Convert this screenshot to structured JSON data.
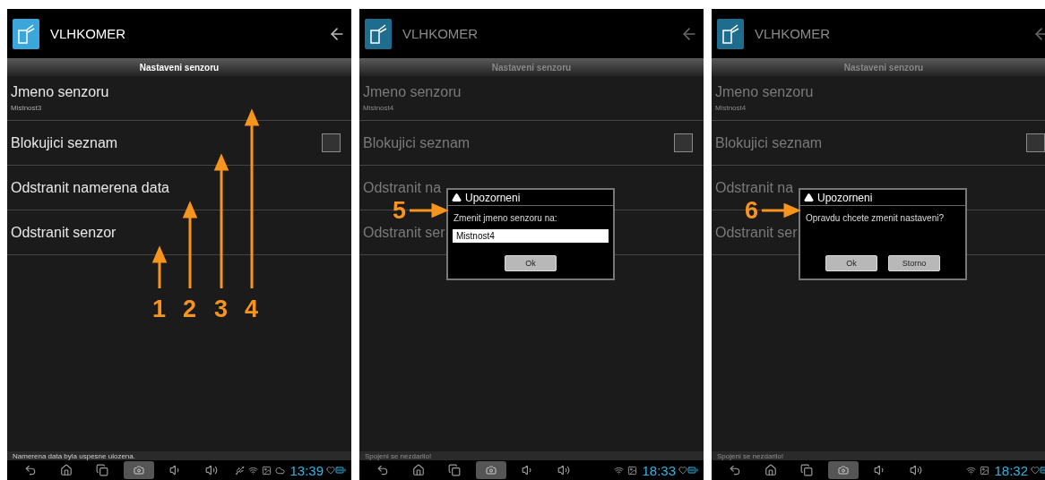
{
  "screens": [
    {
      "app_title": "VLHKOMER",
      "section": "Nastaveni senzoru",
      "dimmed": false,
      "rows": [
        {
          "kind": "text",
          "title": "Jmeno senzoru",
          "subtitle": "Mistnost3"
        },
        {
          "kind": "checkbox",
          "title": "Blokujici seznam",
          "checked": false
        },
        {
          "kind": "text",
          "title": "Odstranit namerena data"
        },
        {
          "kind": "text",
          "title": "Odstranit senzor"
        }
      ],
      "annotations": [
        {
          "label": "1"
        },
        {
          "label": "2"
        },
        {
          "label": "3"
        },
        {
          "label": "4"
        }
      ],
      "status_message": "Namerena data byla uspesne ulozena.",
      "status_icons": [
        {
          "kind": "usb"
        },
        {
          "kind": "wifi"
        },
        {
          "kind": "image"
        },
        {
          "kind": "cloud"
        }
      ],
      "time": "13:39"
    },
    {
      "app_title": "VLHKOMER",
      "section": "Nastaveni senzoru",
      "dimmed": true,
      "rows": [
        {
          "kind": "text",
          "title": "Jmeno senzoru",
          "subtitle": "Mistnost4"
        },
        {
          "kind": "checkbox",
          "title": "Blokujici seznam",
          "checked": false
        },
        {
          "kind": "text",
          "title": "Odstranit na"
        },
        {
          "kind": "text",
          "title": "Odstranit ser"
        }
      ],
      "annotations": [
        {
          "label": "5"
        }
      ],
      "dialog": {
        "title": "Upozorneni",
        "message": "Zmenit jmeno senzoru na:",
        "input_value": "Mistnost4",
        "buttons": [
          "Ok"
        ]
      },
      "status_message": "Spojeni se nezdarilo!",
      "status_icons": [
        {
          "kind": "wifi"
        },
        {
          "kind": "image"
        }
      ],
      "time": "18:33"
    },
    {
      "app_title": "VLHKOMER",
      "section": "Nastaveni senzoru",
      "dimmed": true,
      "rows": [
        {
          "kind": "text",
          "title": "Jmeno senzoru",
          "subtitle": "Mistnost4"
        },
        {
          "kind": "checkbox",
          "title": "Blokujici seznam",
          "checked": false
        },
        {
          "kind": "text",
          "title": "Odstranit na"
        },
        {
          "kind": "text",
          "title": "Odstranit ser"
        }
      ],
      "annotations": [
        {
          "label": "6"
        }
      ],
      "dialog": {
        "title": "Upozorneni",
        "message": "Opravdu chcete zmenit nastaveni?",
        "buttons": [
          "Ok",
          "Storno"
        ]
      },
      "status_message": "Spojeni se nezdarilo!",
      "status_icons": [
        {
          "kind": "wifi"
        },
        {
          "kind": "image"
        }
      ],
      "time": "18:32"
    }
  ]
}
